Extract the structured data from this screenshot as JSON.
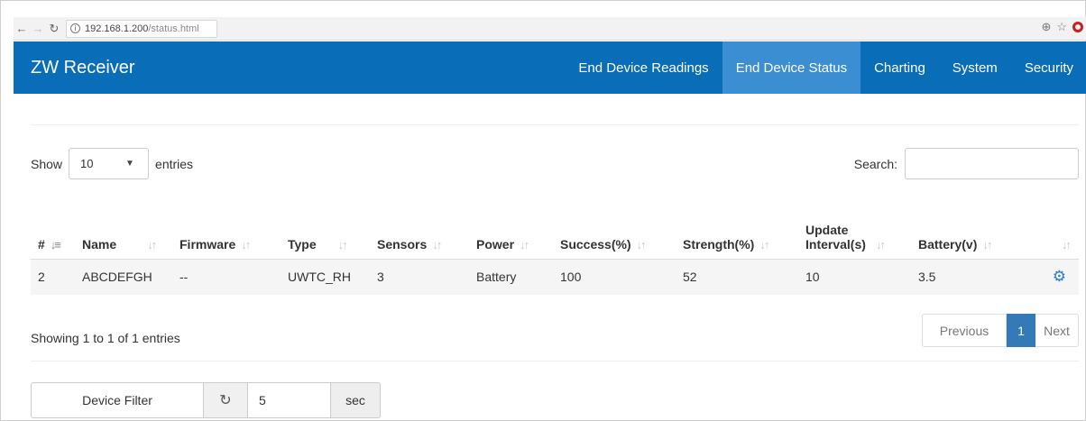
{
  "browser": {
    "url_host": "192.168.1.200",
    "url_path": "/status.html"
  },
  "navbar": {
    "brand": "ZW Receiver",
    "items": [
      {
        "label": "End Device Readings",
        "active": false
      },
      {
        "label": "End Device Status",
        "active": true
      },
      {
        "label": "Charting",
        "active": false
      },
      {
        "label": "System",
        "active": false
      },
      {
        "label": "Security",
        "active": false
      }
    ]
  },
  "length": {
    "show_label": "Show",
    "value": "10",
    "entries_label": "entries"
  },
  "search": {
    "label": "Search:",
    "value": ""
  },
  "table": {
    "headers": [
      "#",
      "Name",
      "Firmware",
      "Type",
      "Sensors",
      "Power",
      "Success(%)",
      "Strength(%)",
      "Update Interval(s)",
      "Battery(v)",
      ""
    ],
    "rows": [
      [
        "2",
        "ABCDEFGH",
        "--",
        "UWTC_RH",
        "3",
        "Battery",
        "100",
        "52",
        "10",
        "3.5"
      ]
    ]
  },
  "info": "Showing 1 to 1 of 1 entries",
  "pager": {
    "previous": "Previous",
    "current": "1",
    "next": "Next"
  },
  "filter": {
    "button_label": "Device Filter",
    "interval_value": "5",
    "unit": "sec"
  },
  "colors": {
    "navbar": "#0a6db8",
    "navbar_active": "#3b8ed1",
    "pager_active": "#337ab7"
  }
}
